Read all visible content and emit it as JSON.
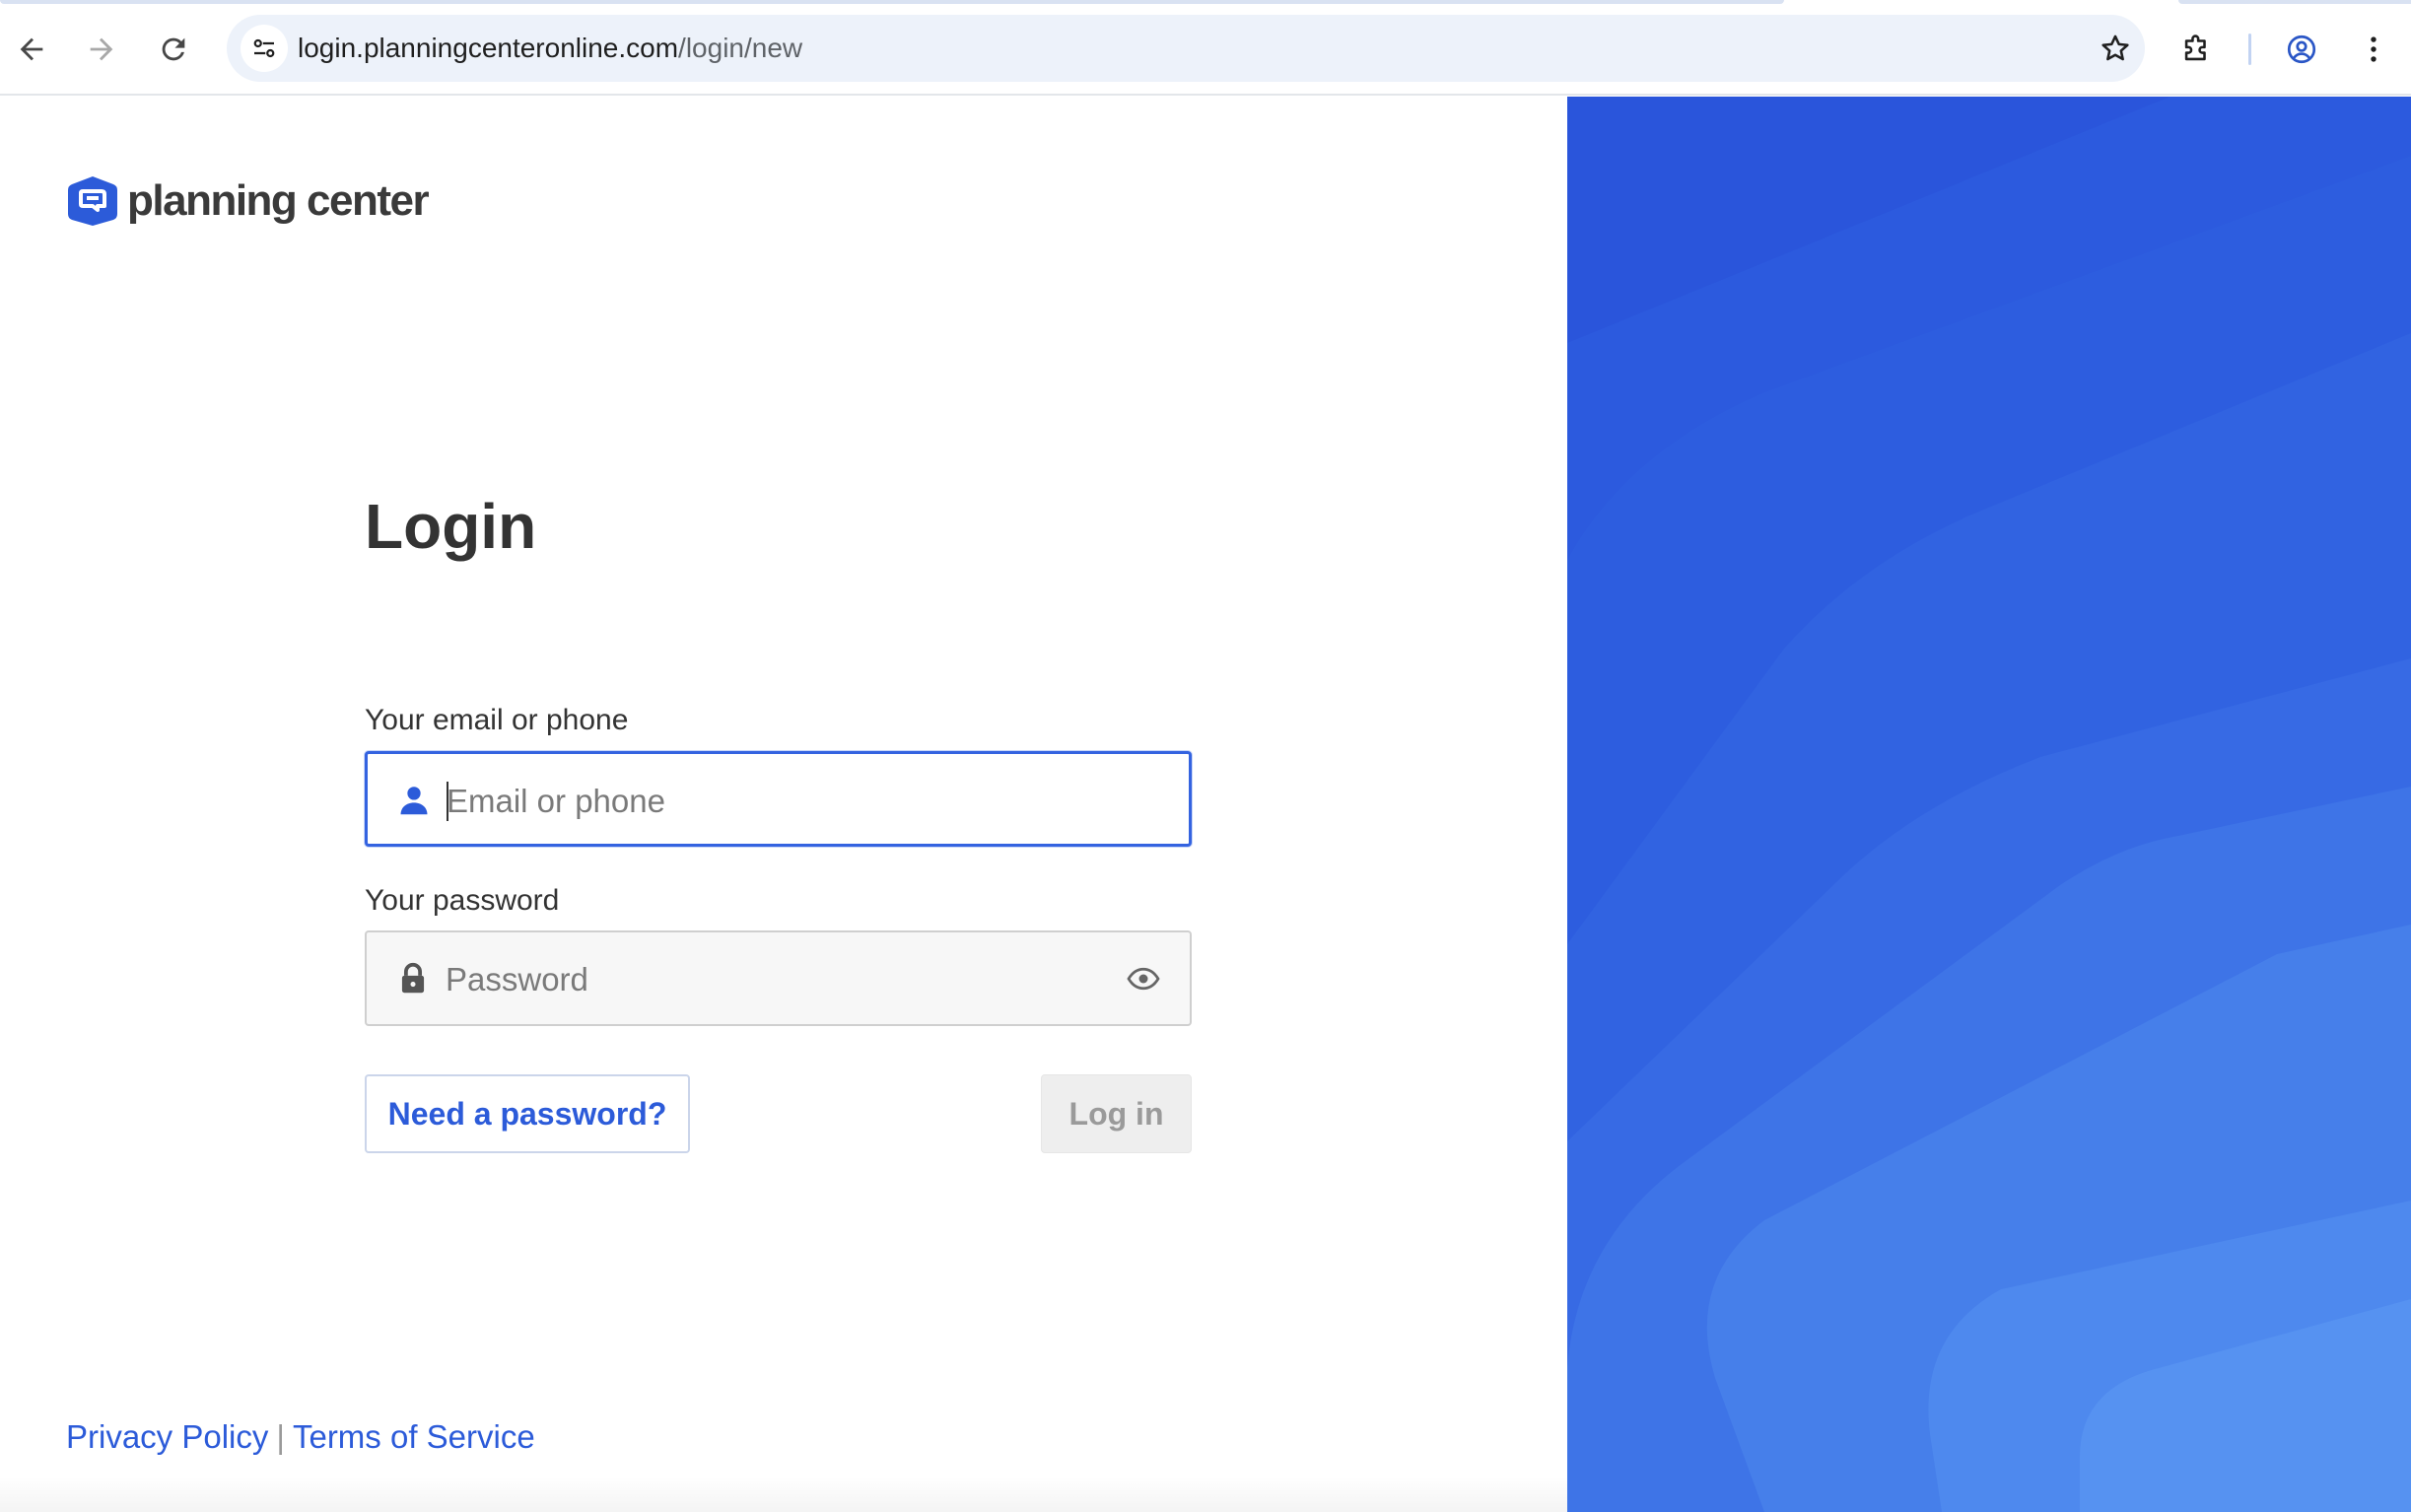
{
  "browser": {
    "url_host": "login.planningcenteronline.com",
    "url_path": "/login/new",
    "icons": {
      "back": "arrow-left-icon",
      "forward": "arrow-right-icon",
      "reload": "reload-icon",
      "site_info": "tune-icon",
      "bookmark": "star-icon",
      "extensions": "puzzle-icon",
      "profile": "account-circle-icon",
      "menu": "more-vert-icon"
    }
  },
  "brand": {
    "name": "planning center",
    "color": "#2c5bd9"
  },
  "login": {
    "title": "Login",
    "email_label": "Your email or phone",
    "email_placeholder": "Email or phone",
    "email_value": "",
    "password_label": "Your password",
    "password_placeholder": "Password",
    "password_value": "",
    "need_password_button": "Need a password?",
    "login_button": "Log in"
  },
  "footer": {
    "privacy": "Privacy Policy",
    "separator": "|",
    "terms": "Terms of Service"
  },
  "colors": {
    "accent": "#2c5bd9",
    "focus_border": "#3463e0",
    "panel_dark": "#2a55db",
    "panel_light": "#5b95f2",
    "disabled_bg": "#eeeeee",
    "disabled_text": "#9a9a9a"
  }
}
